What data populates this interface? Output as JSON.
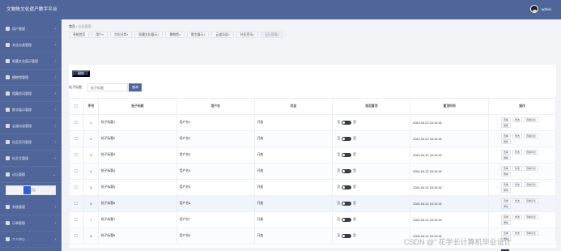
{
  "header": {
    "app_title": "文物陈文化遗产数字平台",
    "username": "admin"
  },
  "sidebar": {
    "items": [
      {
        "label": "用户管理",
        "icon": "user-icon"
      },
      {
        "label": "文化分类管理",
        "icon": "category-icon"
      },
      {
        "label": "收藏文化展示管理",
        "icon": "exhibit-icon"
      },
      {
        "label": "播物馆管理",
        "icon": "museum-icon"
      },
      {
        "label": "馆藏资讯管理",
        "icon": "news-icon"
      },
      {
        "label": "数字展示管理",
        "icon": "display-icon"
      },
      {
        "label": "云道访谈管理",
        "icon": "interview-icon"
      },
      {
        "label": "社区资讯管理",
        "icon": "community-icon"
      },
      {
        "label": "社交互管理",
        "icon": "social-icon"
      },
      {
        "label": "论坛管理",
        "icon": "forum-icon"
      },
      {
        "label": "系统管理",
        "icon": "settings-icon"
      },
      {
        "label": "订单管理",
        "icon": "order-icon"
      },
      {
        "label": "个人中心",
        "icon": "profile-icon"
      }
    ],
    "submenu_label": "论坛"
  },
  "breadcrumb": {
    "home": "首页",
    "current": "论坛管理"
  },
  "tabs": [
    "系统首页",
    "用户",
    "文化分类",
    "收藏文化展示",
    "播物馆",
    "数字展示",
    "云道访谈",
    "社区资讯",
    "论坛管理"
  ],
  "toolbar": {
    "delete_label": "删除",
    "search_label": "帖子标题",
    "search_placeholder": "帖子标题",
    "search_button": "查询"
  },
  "table": {
    "headers": [
      "序号",
      "帖子标题",
      "用户名",
      "状态",
      "是否置顶",
      "置顶时间",
      "操作"
    ],
    "rows": [
      {
        "no": "1",
        "title": "帖子标题1",
        "user": "用户名1",
        "status": "开放",
        "time": "2024-04-22 18:10:18"
      },
      {
        "no": "2",
        "title": "帖子标题2",
        "user": "用户名2",
        "status": "开放",
        "time": "2024-04-22 18:10:18"
      },
      {
        "no": "3",
        "title": "帖子标题3",
        "user": "用户名3",
        "status": "开放",
        "time": "2024-04-22 18:10:18"
      },
      {
        "no": "4",
        "title": "帖子标题4",
        "user": "用户名4",
        "status": "开放",
        "time": "2024-04-22 18:10:18"
      },
      {
        "no": "5",
        "title": "帖子标题5",
        "user": "用户名5",
        "status": "开放",
        "time": "2024-04-22 18:10:18"
      },
      {
        "no": "6",
        "title": "帖子标题6",
        "user": "用户名6",
        "status": "开放",
        "time": "2024-04-22 18:10:18"
      },
      {
        "no": "7",
        "title": "帖子标题7",
        "user": "用户名7",
        "status": "开放",
        "time": "2024-04-22 18:10:18"
      },
      {
        "no": "8",
        "title": "帖子标题8",
        "user": "用户名8",
        "status": "开放",
        "time": "2024-04-22 18:10:18"
      }
    ],
    "switch_labels": [
      "否",
      "是"
    ],
    "actions": [
      "查看",
      "修改",
      "查看评论",
      "删除"
    ]
  },
  "pagination": {
    "current": "1"
  },
  "watermark": "CSDN @“ 花学长计算机毕业设计"
}
